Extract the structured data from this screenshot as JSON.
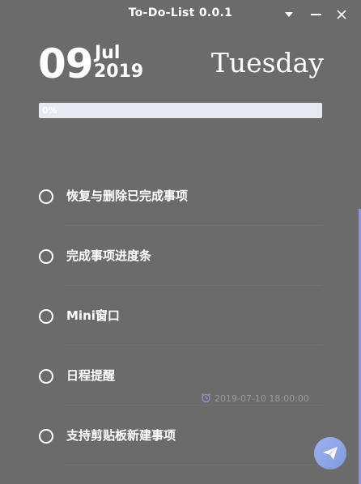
{
  "window": {
    "title": "To-Do-List 0.0.1"
  },
  "header": {
    "day": "09",
    "month": "Jul",
    "year": "2019",
    "weekday": "Tuesday"
  },
  "progress": {
    "label": "0%",
    "value": 0
  },
  "tasks": [
    {
      "label": "恢复与删除已完成事项",
      "completed": false
    },
    {
      "label": "完成事项进度条",
      "completed": false
    },
    {
      "label": "Mini窗口",
      "completed": false
    },
    {
      "label": "日程提醒",
      "completed": false,
      "reminder": "2019-07-10 18:00:00"
    },
    {
      "label": "支持剪贴板新建事项",
      "completed": false
    }
  ],
  "colors": {
    "background": "#6b6b6b",
    "accent": "#8f95d8",
    "progress_track": "#e8e9f3"
  },
  "icons": {
    "reminder": "alarm-clock-icon",
    "send": "paper-plane-icon",
    "dropdown": "triangle-down-icon",
    "minimize": "minimize-icon",
    "close": "close-icon"
  }
}
